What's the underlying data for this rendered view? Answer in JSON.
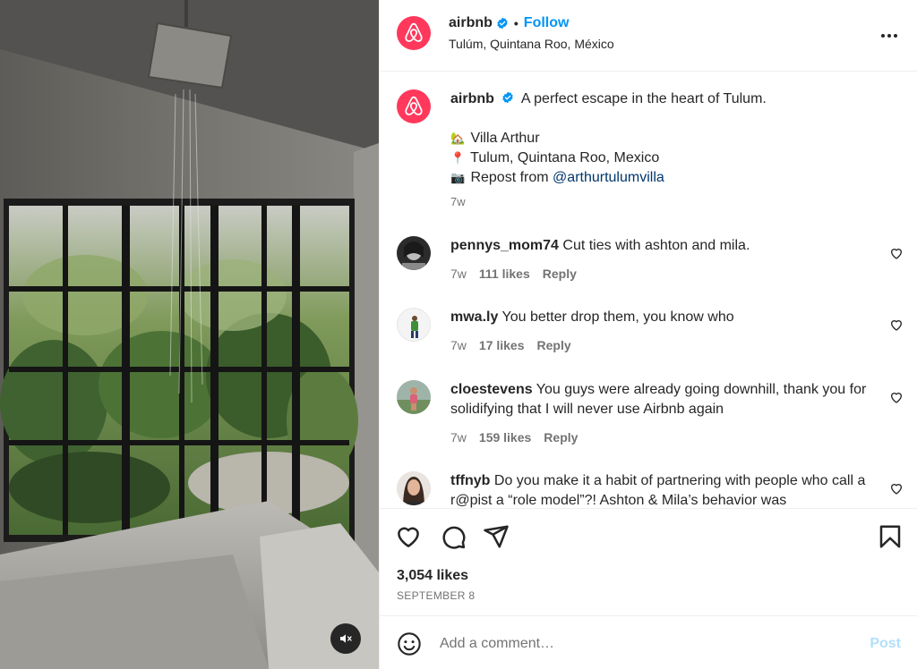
{
  "post": {
    "account": "airbnb",
    "follow_label": "Follow",
    "separator": "•",
    "location": "Tulúm, Quintana Roo, México",
    "brand_color": "#ff385c",
    "link_color": "#0095f6"
  },
  "caption": {
    "username": "airbnb",
    "text": "A perfect escape in the heart of Tulum.",
    "lines": [
      {
        "emoji": "🏡",
        "text": "Villa Arthur"
      },
      {
        "emoji": "📍",
        "text": "Tulum, Quintana Roo, Mexico"
      },
      {
        "emoji": "📷",
        "text": "Repost from ",
        "mention": "@arthurtulumvilla"
      }
    ],
    "time": "7w"
  },
  "comments": [
    {
      "username": "pennys_mom74",
      "text": "Cut ties with ashton and mila.",
      "time": "7w",
      "likes": "111 likes",
      "reply": "Reply"
    },
    {
      "username": "mwa.ly",
      "text": "You better drop them, you know who",
      "time": "7w",
      "likes": "17 likes",
      "reply": "Reply"
    },
    {
      "username": "cloestevens",
      "text": "You guys were already going downhill, thank you for solidifying that I will never use Airbnb again",
      "time": "7w",
      "likes": "159 likes",
      "reply": "Reply"
    },
    {
      "username": "tffnyb",
      "text": "Do you make it a habit of partnering with people who call a r@pist a “role model”?! Ashton & Mila’s behavior was",
      "time": "",
      "likes": "",
      "reply": ""
    }
  ],
  "engagement": {
    "likes": "3,054 likes",
    "date": "SEPTEMBER 8"
  },
  "comment_box": {
    "placeholder": "Add a comment…",
    "post_label": "Post"
  },
  "icons": [
    "airbnb-logo-icon",
    "verified-icon",
    "more-icon",
    "heart-icon",
    "comment-icon",
    "share-icon",
    "bookmark-icon",
    "emoji-icon",
    "mute-icon"
  ]
}
